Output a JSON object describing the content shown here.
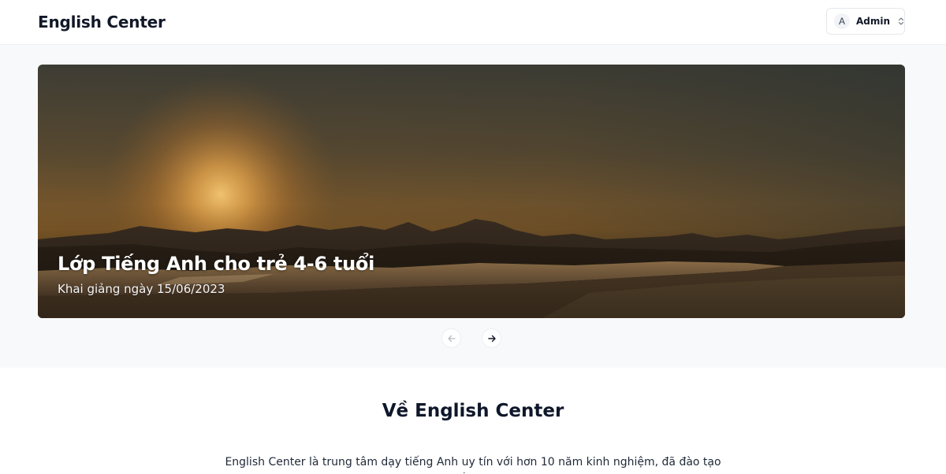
{
  "header": {
    "brand": "English Center",
    "user": {
      "avatar_initial": "A",
      "name": "Admin"
    }
  },
  "carousel": {
    "slide": {
      "title": "Lớp Tiếng Anh cho trẻ 4-6 tuổi",
      "subtitle": "Khai giảng ngày 15/06/2023"
    },
    "prev_icon": "arrow-left-icon",
    "next_icon": "arrow-right-icon"
  },
  "about": {
    "title": "Về English Center",
    "text": "English Center là trung tâm dạy tiếng Anh uy tín với hơn 10 năm kinh nghiệm, đã đào tạo hơn"
  },
  "colors": {
    "header_bg": "#ffffff",
    "page_bg": "#f8f9fb",
    "text_primary": "#111827"
  }
}
